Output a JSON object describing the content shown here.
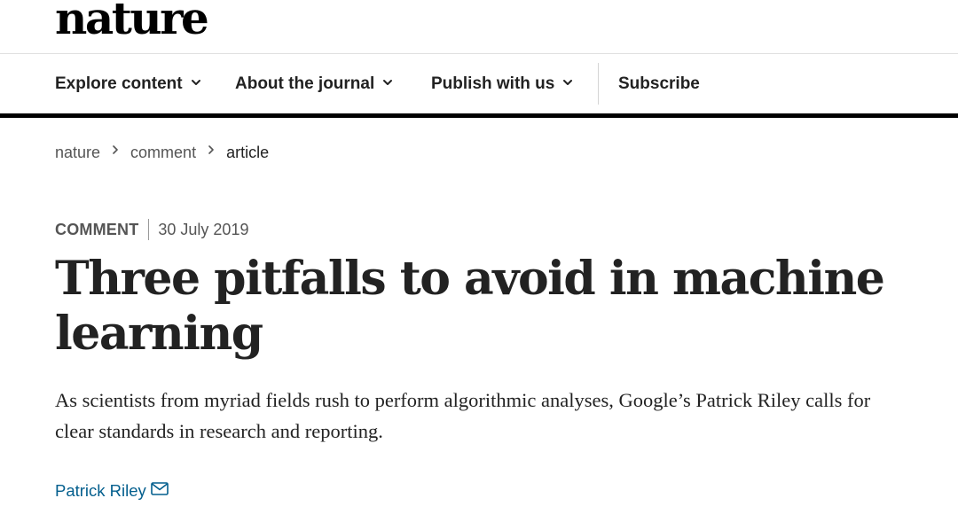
{
  "header": {
    "logo_text": "nature"
  },
  "nav": {
    "items": [
      {
        "label": "Explore content",
        "has_dropdown": true,
        "icon": "chevron-down-icon"
      },
      {
        "label": "About the journal",
        "has_dropdown": true,
        "icon": "chevron-down-icon"
      },
      {
        "label": "Publish with us",
        "has_dropdown": true,
        "icon": "chevron-down-icon"
      },
      {
        "label": "Subscribe",
        "has_dropdown": false
      }
    ]
  },
  "breadcrumb": {
    "items": [
      "nature",
      "comment",
      "article"
    ],
    "separator_icon": "chevron-right-icon"
  },
  "article": {
    "type": "COMMENT",
    "date": "30 July 2019",
    "title": "Three pitfalls to avoid in machine learning",
    "standfirst": "As scientists from myriad fields rush to perform algorithmic analyses, Google’s Patrick Riley calls for clear standards in research and reporting.",
    "author": "Patrick Riley",
    "author_icon": "mail-icon"
  },
  "colors": {
    "text": "#222222",
    "muted": "#555555",
    "link": "#025e8d",
    "nav_underline": "#000000"
  }
}
